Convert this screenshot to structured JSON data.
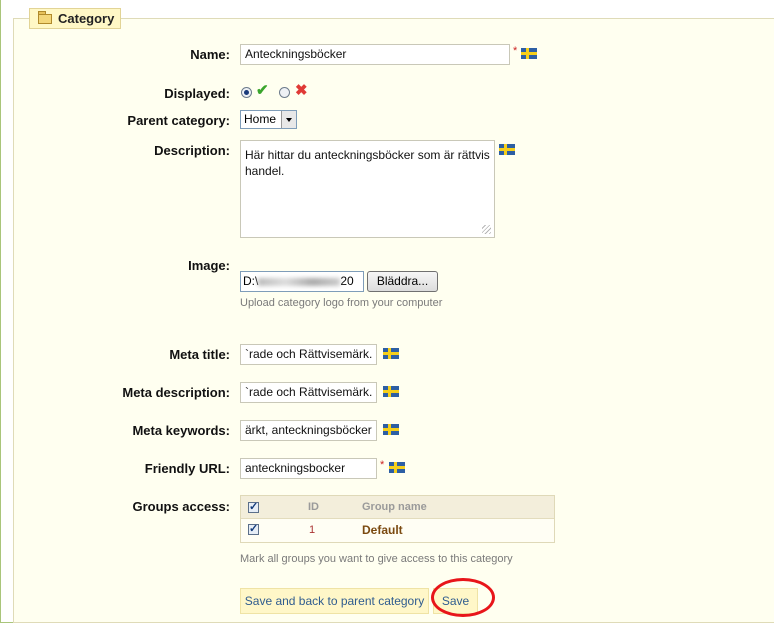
{
  "legend": {
    "title": "Category",
    "icon": "folder-icon"
  },
  "fields": {
    "name": {
      "label": "Name:",
      "value": "Anteckningsböcker",
      "required_mark": "*"
    },
    "displayed": {
      "label": "Displayed:",
      "selected": "yes"
    },
    "parent": {
      "label": "Parent category:",
      "value": "Home"
    },
    "description": {
      "label": "Description:",
      "value": "Här hittar du anteckningsböcker som är rättvis handel."
    },
    "image": {
      "label": "Image:",
      "path_start": "D:\\",
      "path_end": "20",
      "browse_label": "Bläddra...",
      "hint": "Upload category logo from your computer"
    },
    "meta_title": {
      "label": "Meta title:",
      "value": "`rade och Rättvisemärk."
    },
    "meta_description": {
      "label": "Meta description:",
      "value": "`rade och Rättvisemärk."
    },
    "meta_keywords": {
      "label": "Meta keywords:",
      "value": "ärkt, anteckningsböcker"
    },
    "friendly_url": {
      "label": "Friendly URL:",
      "value": "anteckningsbocker",
      "required_mark": "*"
    },
    "groups": {
      "label": "Groups access:",
      "columns": [
        "ID",
        "Group name"
      ],
      "rows": [
        {
          "id": "1",
          "name": "Default",
          "checked": true
        }
      ],
      "hint": "Mark all groups you want to give access to this category"
    }
  },
  "actions": {
    "save_back_label": "Save and back to parent category",
    "save_label": "Save"
  },
  "colors": {
    "panel_bg": "#fffff0",
    "legend_bg": "#fff8c6",
    "button_bg": "#fff7c8",
    "link_text": "#2f5c8f",
    "highlight": "#e8151a"
  }
}
